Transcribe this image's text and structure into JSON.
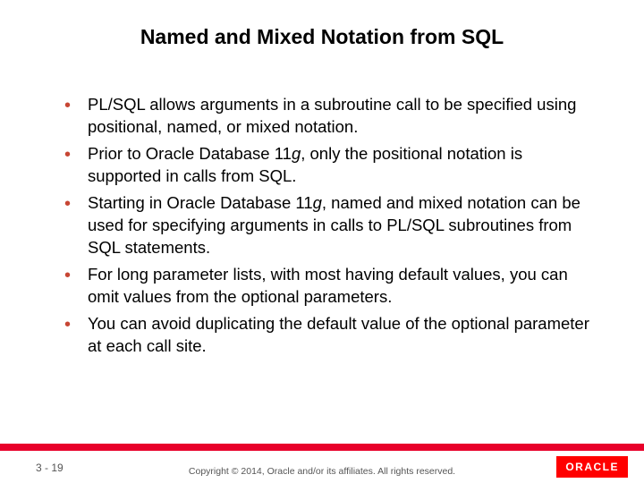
{
  "slide": {
    "title": "Named and Mixed Notation from SQL",
    "bullets": [
      {
        "pre": "PL/SQL allows arguments in a subroutine call to be specified using positional, named, or mixed notation.",
        "italic": "",
        "post": ""
      },
      {
        "pre": "Prior to Oracle Database 11",
        "italic": "g",
        "post": ", only the positional notation is supported in calls from SQL."
      },
      {
        "pre": "Starting in Oracle Database 11",
        "italic": "g",
        "post": ", named and mixed notation can be used for specifying arguments in calls to PL/SQL subroutines from SQL statements."
      },
      {
        "pre": "For long parameter lists, with most having default values, you can omit values from the optional parameters.",
        "italic": "",
        "post": ""
      },
      {
        "pre": "You can avoid duplicating the default value of the optional parameter at each call site.",
        "italic": "",
        "post": ""
      }
    ]
  },
  "footer": {
    "page": "3 - 19",
    "copyright": "Copyright © 2014, Oracle and/or its affiliates. All rights reserved.",
    "logo": "ORACLE"
  }
}
